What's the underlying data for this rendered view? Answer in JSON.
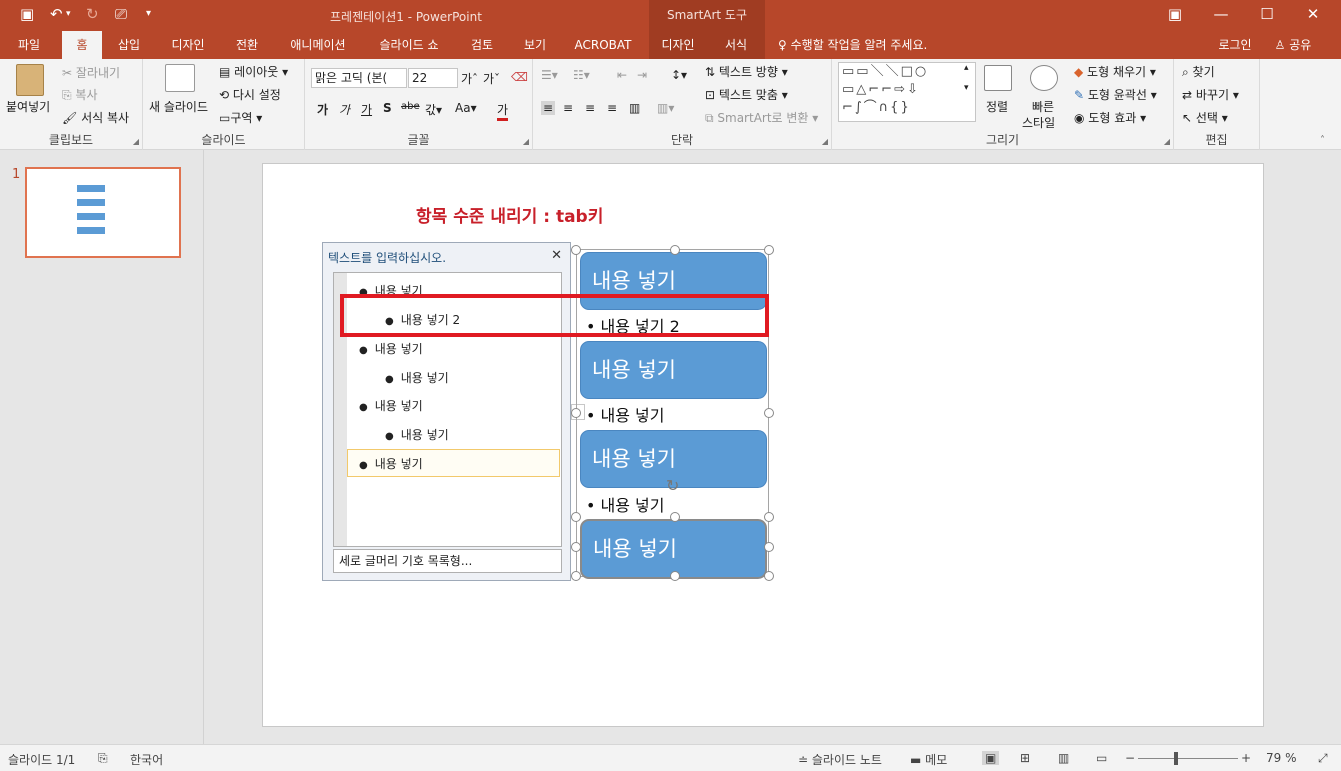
{
  "window": {
    "title": "프레젠테이션1 - PowerPoint",
    "context_tool": "SmartArt 도구",
    "quick_access": {
      "save_icon": "save-icon",
      "undo_icon": "undo-icon",
      "redo_icon": "redo-icon",
      "slideshow_icon": "present-icon",
      "customize": "▾"
    },
    "controls": {
      "options": "▣",
      "minimize": "—",
      "maximize": "☐",
      "close": "✕"
    }
  },
  "tabs": [
    {
      "label": "파일"
    },
    {
      "label": "홈"
    },
    {
      "label": "삽입"
    },
    {
      "label": "디자인"
    },
    {
      "label": "전환"
    },
    {
      "label": "애니메이션"
    },
    {
      "label": "슬라이드 쇼"
    },
    {
      "label": "검토"
    },
    {
      "label": "보기"
    },
    {
      "label": "ACROBAT"
    },
    {
      "label": "디자인"
    },
    {
      "label": "서식"
    }
  ],
  "tell_me": "수행할 작업을 알려 주세요.",
  "account": {
    "login": "로그인",
    "share": "공유"
  },
  "ribbon": {
    "clipboard": {
      "paste": "붙여넣기",
      "cut": "잘라내기",
      "copy": "복사",
      "format_painter": "서식 복사",
      "label": "클립보드"
    },
    "slides": {
      "new_slide": "새 슬라이드",
      "layout": "레이아웃",
      "reset": "다시 설정",
      "section": "구역",
      "label": "슬라이드"
    },
    "font": {
      "name": "맑은 고딕 (본(",
      "size": "22",
      "label": "글꼴"
    },
    "paragraph": {
      "text_direction": "텍스트 방향",
      "align_text": "텍스트 맞춤",
      "convert_smartart": "SmartArt로 변환",
      "label": "단락"
    },
    "drawing": {
      "arrange": "정렬",
      "quick_styles_1": "빠른",
      "quick_styles_2": "스타일",
      "shape_fill": "도형 채우기",
      "shape_outline": "도형 윤곽선",
      "shape_effects": "도형 효과",
      "label": "그리기"
    },
    "editing": {
      "find": "찾기",
      "replace": "바꾸기",
      "select": "선택",
      "label": "편집"
    }
  },
  "thumbnail": {
    "number": "1"
  },
  "slide": {
    "title": "항목 수준 내리기 : tab키",
    "text_pane": {
      "title": "텍스트를 입력하십시오.",
      "close": "✕",
      "items": [
        {
          "text": "내용 넣기",
          "level": 1
        },
        {
          "text": "내용 넣기 2",
          "level": 2
        },
        {
          "text": "내용 넣기",
          "level": 1
        },
        {
          "text": "내용 넣기",
          "level": 2
        },
        {
          "text": "내용 넣기",
          "level": 1
        },
        {
          "text": "내용 넣기",
          "level": 2
        },
        {
          "text": "내용 넣기",
          "level": 1
        }
      ],
      "footer": "세로 글머리 기호 목록형..."
    },
    "smartart": {
      "boxes": [
        "내용 넣기",
        "내용 넣기",
        "내용 넣기",
        "내용 넣기"
      ],
      "subs": [
        "• 내용 넣기 2",
        "• 내용 넣기",
        "• 내용 넣기"
      ]
    }
  },
  "status": {
    "slide": "슬라이드 1/1",
    "language": "한국어",
    "notes": "슬라이드 노트",
    "comments": "메모",
    "zoom": "79 %"
  },
  "colors": {
    "accent": "#b7472a",
    "smartart_fill": "#5b9bd5",
    "highlight": "#e01a22"
  }
}
